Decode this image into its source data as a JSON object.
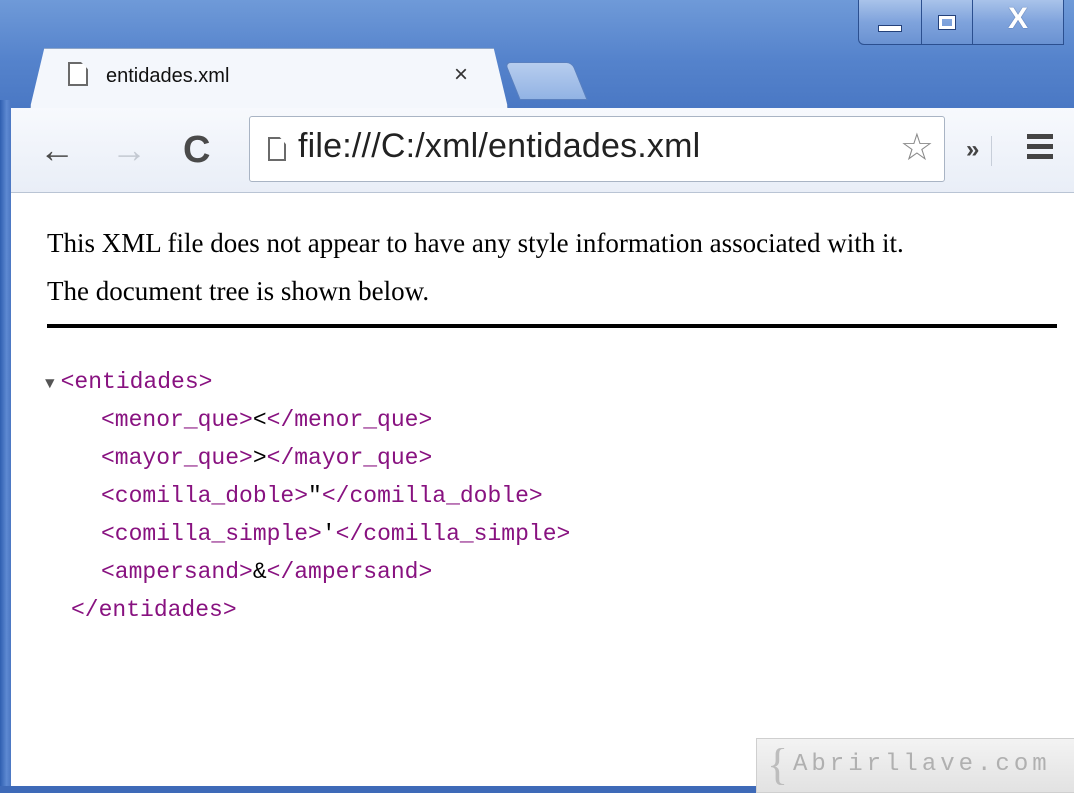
{
  "window": {
    "buttons": {
      "minimize": "minimize-icon",
      "maximize": "maximize-icon",
      "close": "close-icon"
    }
  },
  "tab": {
    "title": "entidades.xml",
    "close_glyph": "×"
  },
  "toolbar": {
    "back_glyph": "←",
    "forward_glyph": "→",
    "reload_glyph": "C",
    "url": "file:///C:/xml/entidades.xml",
    "star_glyph": "☆",
    "overflow_glyph": "»"
  },
  "page": {
    "info_text": "This XML file does not appear to have any style information associated with it. The document tree is shown below."
  },
  "xml_tree": {
    "root_open": "<entidades>",
    "root_close": "</entidades>",
    "children": [
      {
        "open": "<menor_que>",
        "value": "<",
        "close": "</menor_que>"
      },
      {
        "open": "<mayor_que>",
        "value": ">",
        "close": "</mayor_que>"
      },
      {
        "open": "<comilla_doble>",
        "value": "\"",
        "close": "</comilla_doble>"
      },
      {
        "open": "<comilla_simple>",
        "value": "'",
        "close": "</comilla_simple>"
      },
      {
        "open": "<ampersand>",
        "value": "&",
        "close": "</ampersand>"
      }
    ]
  },
  "watermark": {
    "brace": "{",
    "text": "Abrirllave.com"
  },
  "colors": {
    "tag": "#881280",
    "titlebar": "#5583cc"
  }
}
